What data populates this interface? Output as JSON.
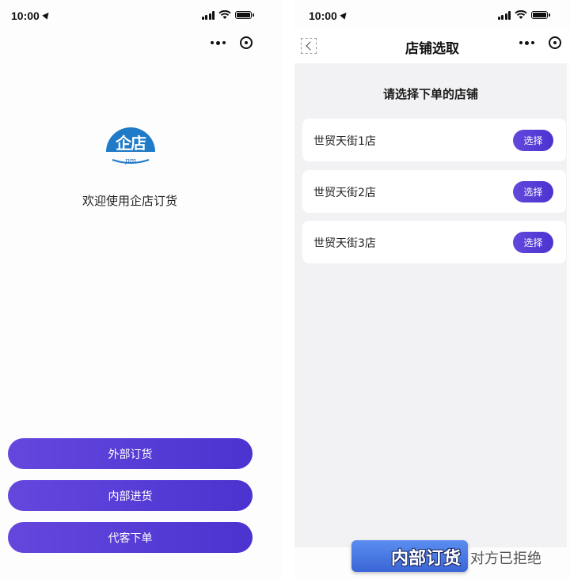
{
  "left_screen": {
    "status_bar": {
      "time": "10:00"
    },
    "logo": {
      "text": "企店",
      "subtext": "pm"
    },
    "welcome_text": "欢迎使用企店订货",
    "buttons": [
      {
        "label": "外部订货"
      },
      {
        "label": "内部进货"
      },
      {
        "label": "代客下单"
      }
    ]
  },
  "right_screen": {
    "status_bar": {
      "time": "10:00"
    },
    "nav_title": "店铺选取",
    "prompt": "请选择下单的店铺",
    "stores": [
      {
        "name": "世贸天街1店",
        "action": "选择"
      },
      {
        "name": "世贸天街2店",
        "action": "选择"
      },
      {
        "name": "世贸天街3店",
        "action": "选择"
      }
    ]
  },
  "overlay": {
    "badge_text": "内部订货",
    "tail_text": "对方已拒绝"
  },
  "colors": {
    "accent": "#5a3fd9",
    "logo_blue": "#1f6fb8",
    "content_bg": "#f2f2f4"
  }
}
